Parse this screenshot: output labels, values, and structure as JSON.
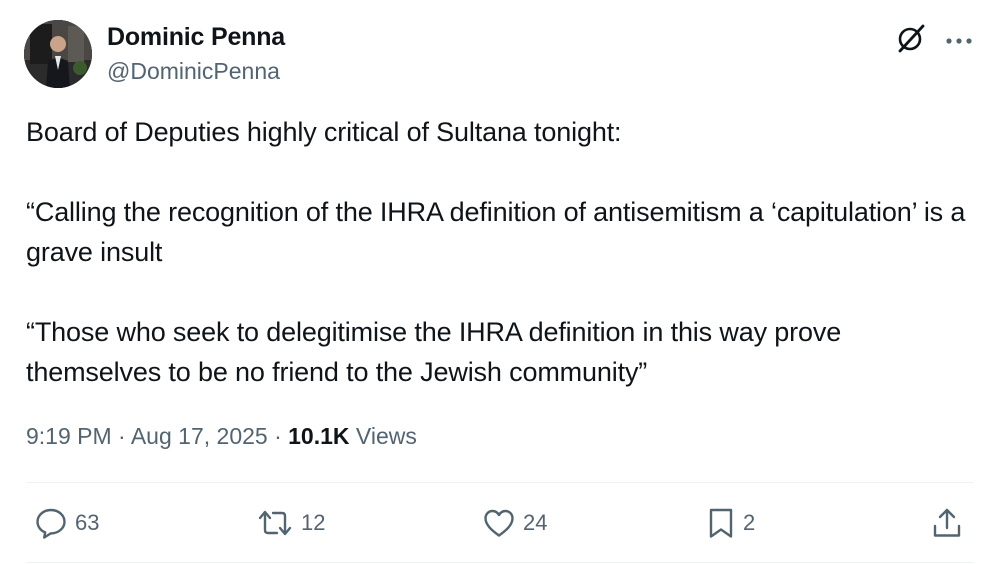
{
  "author": {
    "display_name": "Dominic Penna",
    "handle": "@DominicPenna"
  },
  "header_icons": [
    "grok-icon",
    "more-icon"
  ],
  "tweet": {
    "paragraphs": [
      "Board of Deputies highly critical of Sultana tonight:",
      "“Calling the recognition of the IHRA definition of antisemitism a ‘capitulation’ is a grave insult",
      "“Those who seek to delegitimise the IHRA definition in this way prove themselves to be no friend to the Jewish community”"
    ]
  },
  "meta": {
    "time": "9:19 PM",
    "separator": "·",
    "date": "Aug 17, 2025",
    "views_count": "10.1K",
    "views_label": "Views"
  },
  "actions": {
    "reply": {
      "icon": "reply-icon",
      "count": "63"
    },
    "repost": {
      "icon": "repost-icon",
      "count": "12"
    },
    "like": {
      "icon": "heart-icon",
      "count": "24"
    },
    "bookmark": {
      "icon": "bookmark-icon",
      "count": "2"
    },
    "share": {
      "icon": "share-icon"
    }
  },
  "colors": {
    "text": "#0f1419",
    "secondary": "#536471",
    "divider": "#eff3f4"
  }
}
